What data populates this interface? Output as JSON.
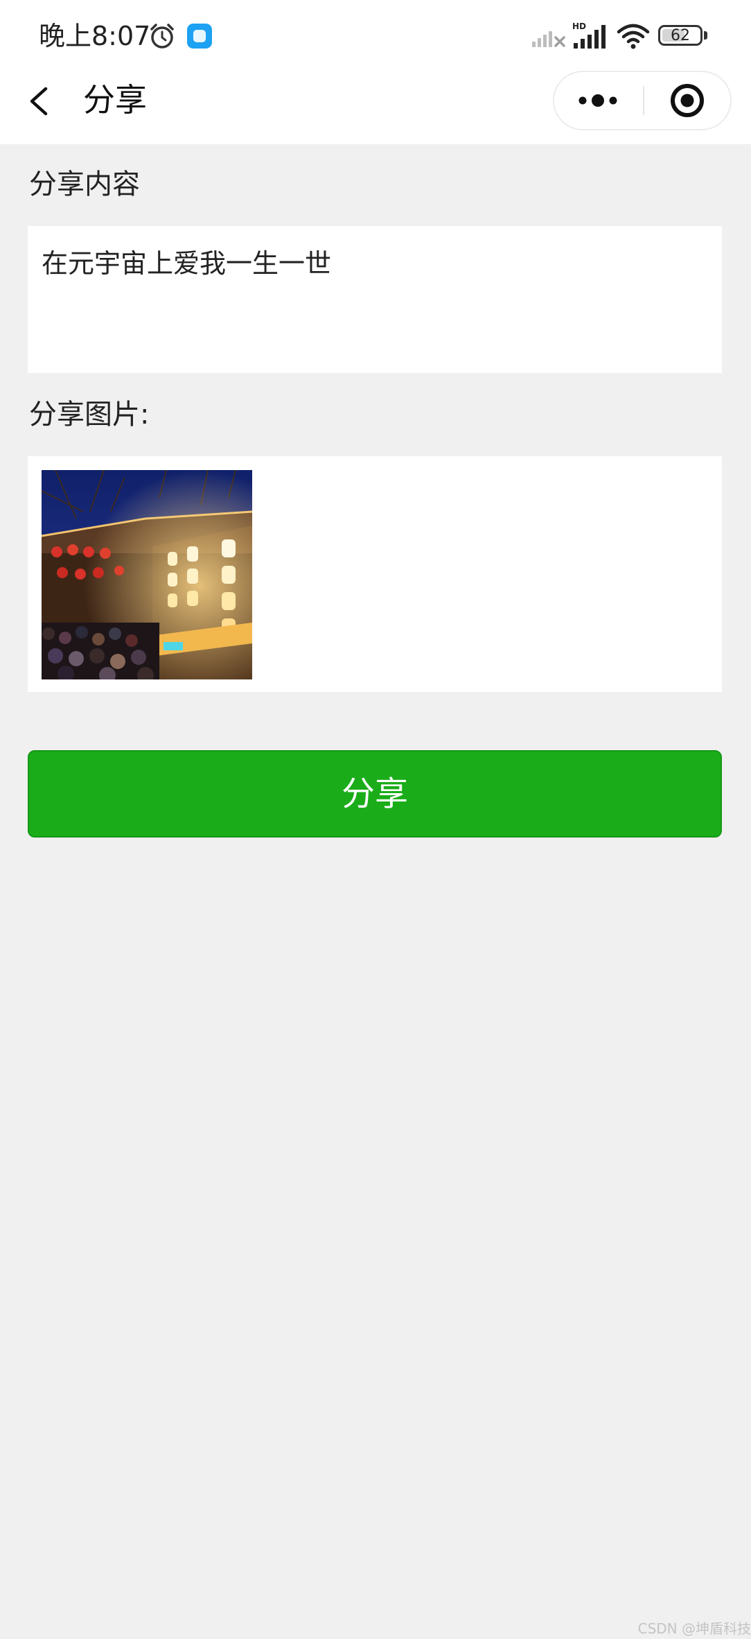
{
  "status_bar": {
    "time": "晚上8:07",
    "battery_level": "62",
    "battery_fraction": 0.62,
    "icons": [
      "alarm-icon",
      "app-notification-icon",
      "signal-no-service-icon",
      "signal-hd-icon",
      "wifi-icon",
      "battery-icon"
    ]
  },
  "nav": {
    "title": "分享",
    "back_icon": "chevron-left-icon",
    "more_icon": "more-dots-icon",
    "close_icon": "miniprogram-close-icon"
  },
  "form": {
    "content_label": "分享内容",
    "content_value": "在元宇宙上爱我一生一世",
    "image_label": "分享图片:",
    "image_description": "night-street-lanterns-photo",
    "submit_label": "分享"
  },
  "colors": {
    "accent": "#1aad19",
    "page_background": "#f0f0f0",
    "card_background": "#ffffff"
  },
  "watermark": "CSDN @坤盾科技"
}
